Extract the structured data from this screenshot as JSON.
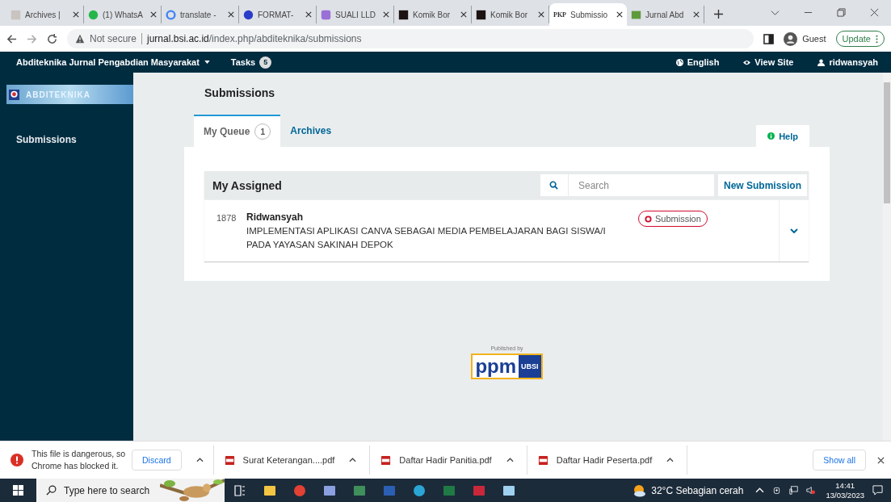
{
  "browser": {
    "tabs": [
      {
        "label": "Archives |",
        "selected": false,
        "kind": "page"
      },
      {
        "label": "(1) WhatsA",
        "selected": false,
        "kind": "whatsapp"
      },
      {
        "label": "translate -",
        "selected": false,
        "kind": "google"
      },
      {
        "label": "FORMAT-",
        "selected": false,
        "kind": "globe"
      },
      {
        "label": "SUALI LLD",
        "selected": false,
        "kind": "app"
      },
      {
        "label": "Komik Bor",
        "selected": false,
        "kind": "dark"
      },
      {
        "label": "Komik Bor",
        "selected": false,
        "kind": "dark"
      },
      {
        "label": "Submissio",
        "selected": true,
        "kind": "text",
        "favicon_text": "PKP"
      },
      {
        "label": "Jurnal Abd",
        "selected": false
      }
    ],
    "address": {
      "security": "Not secure",
      "host": "jurnal.bsi.ac.id",
      "path": "/index.php/abditeknika/submissions"
    },
    "profile": "Guest",
    "update_button": "Update"
  },
  "navbar": {
    "journal": "Abditeknika Jurnal Pengabdian Masyarakat",
    "tasks": "Tasks",
    "tasks_count": "5",
    "language": "English",
    "view_site": "View Site",
    "user": "ridwansyah"
  },
  "sidebar": {
    "logo_text": "ABDITEKNIKA",
    "items": [
      {
        "label": "Submissions",
        "selected": true
      }
    ]
  },
  "page": {
    "title": "Submissions",
    "tabs": [
      {
        "label": "My Queue",
        "count": "1",
        "selected": true
      },
      {
        "label": "Archives",
        "selected": false
      }
    ],
    "help": "Help",
    "list": {
      "title": "My Assigned",
      "search": {
        "placeholder": "Search"
      },
      "new_button": "New Submission",
      "rows": [
        {
          "id": "1878",
          "author": "Ridwansyah",
          "title": "IMPLEMENTASI APLIKASI CANVA SEBAGAI MEDIA PEMBELAJARAN BAGI SISWA/I PADA YAYASAN SAKINAH DEPOK",
          "stage": "Submission",
          "expanded": false
        }
      ]
    }
  },
  "footer": {
    "caption": "Published by",
    "logo_text": "ppm",
    "logo_side": "UBSI"
  },
  "downloads": {
    "warning": {
      "text": "This file is dangerous, so Chrome has blocked it.",
      "button": "Discard"
    },
    "files": [
      {
        "name": "Surat Keterangan....pdf"
      },
      {
        "name": "Daftar Hadir Panitia.pdf"
      },
      {
        "name": "Daftar Hadir Peserta.pdf"
      }
    ],
    "show_all": "Show all"
  },
  "taskbar": {
    "search": {
      "placeholder": "Type here to search"
    },
    "weather": "32°C Sebagian cerah",
    "time": "14:41",
    "date": "13/03/2023"
  }
}
